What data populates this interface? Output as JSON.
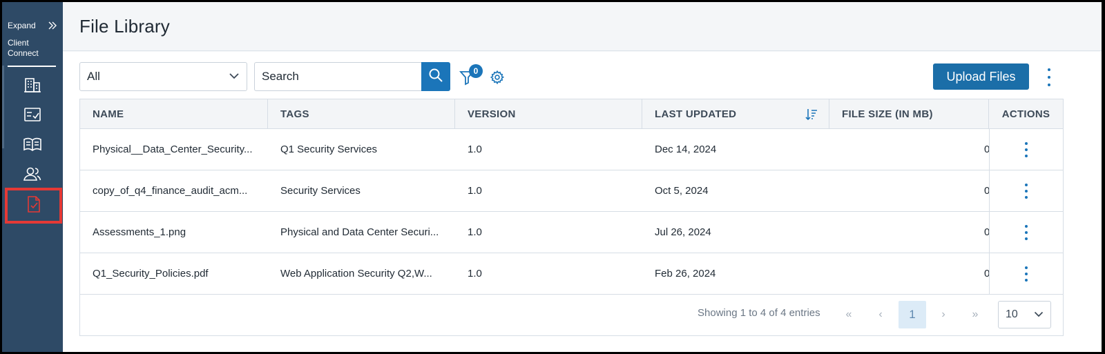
{
  "sidebar": {
    "expand_label": "Expand",
    "app_name": "Client Connect",
    "items": [
      {
        "name": "buildings-icon"
      },
      {
        "name": "checklist-icon"
      },
      {
        "name": "open-book-icon"
      },
      {
        "name": "users-icon"
      },
      {
        "name": "document-check-icon",
        "active": true
      }
    ],
    "active_color": "#e53935"
  },
  "header": {
    "title": "File Library"
  },
  "toolbar": {
    "filter_select_value": "All",
    "search_placeholder": "Search",
    "filter_count": "0",
    "upload_label": "Upload Files"
  },
  "table": {
    "columns": [
      "NAME",
      "TAGS",
      "VERSION",
      "LAST UPDATED",
      "FILE SIZE (IN MB)",
      "ACTIONS"
    ],
    "rows": [
      {
        "name": "Physical__Data_Center_Security...",
        "tags": "Q1 Security Services",
        "version": "1.0",
        "updated": "Dec 14, 2024",
        "size": "0"
      },
      {
        "name": "copy_of_q4_finance_audit_acm...",
        "tags": "Security Services",
        "version": "1.0",
        "updated": "Oct 5, 2024",
        "size": "0"
      },
      {
        "name": "Assessments_1.png",
        "tags": "Physical and Data Center Securi...",
        "version": "1.0",
        "updated": "Jul 26, 2024",
        "size": "0"
      },
      {
        "name": "Q1_Security_Policies.pdf",
        "tags": "Web Application Security Q2,W...",
        "version": "1.0",
        "updated": "Feb 26, 2024",
        "size": "0"
      }
    ]
  },
  "pagination": {
    "showing": "Showing 1 to 4 of 4 entries",
    "first": "«",
    "prev": "‹",
    "current": "1",
    "next": "›",
    "last": "»",
    "page_size": "10"
  },
  "colors": {
    "sidebar_bg": "#2e4a66",
    "accent": "#1b75b9",
    "upload_bg": "#1b6ea8"
  }
}
